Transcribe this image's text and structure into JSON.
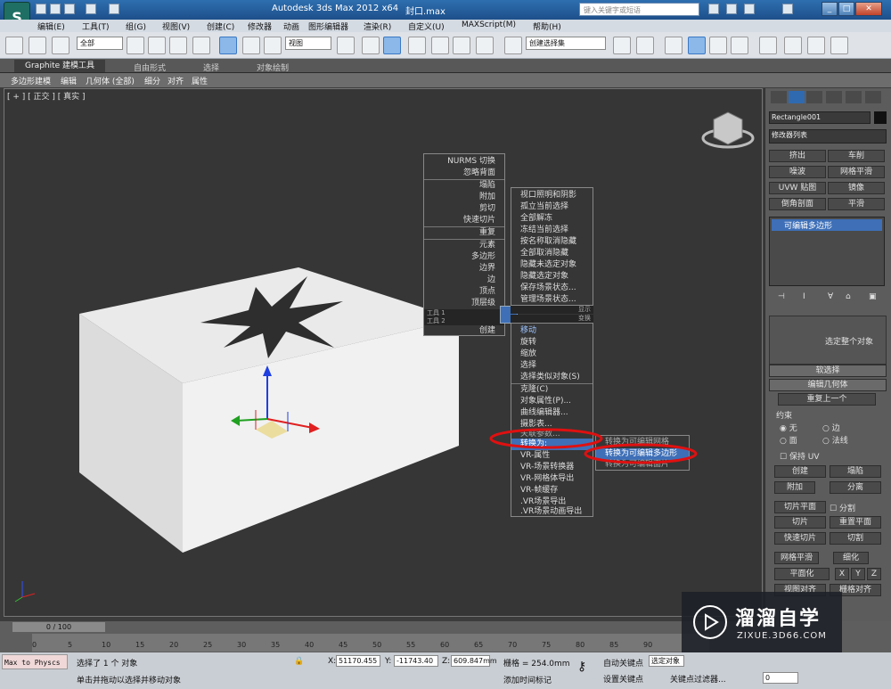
{
  "app": {
    "title": "Autodesk 3ds Max  2012 x64",
    "file": "封口.max",
    "search_placeholder": "键入关键字或短语",
    "logo": "S"
  },
  "menubar": [
    "编辑(E)",
    "工具(T)",
    "组(G)",
    "视图(V)",
    "创建(C)",
    "修改器",
    "动画",
    "图形编辑器",
    "渲染(R)",
    "自定义(U)",
    "MAXScript(M)",
    "帮助(H)"
  ],
  "toolbar": {
    "selection_filter": "全部",
    "ref_coord": "视图",
    "named_selection": "创建选择集"
  },
  "ribbon": {
    "tabs": [
      "Graphite 建模工具",
      "自由形式",
      "选择",
      "对象绘制"
    ],
    "sub": [
      "多边形建模",
      "编辑",
      "几何体 (全部)",
      "细分",
      "对齐",
      "属性"
    ]
  },
  "viewport": {
    "label": "[ + ] [ 正交 ] [ 真实 ]"
  },
  "quad_menu": {
    "left": {
      "top_items": [
        "NURMS 切换",
        "忽略背面",
        "塌陷",
        "附加",
        "剪切",
        "快速切片",
        "重复"
      ],
      "sub_items": [
        "元素",
        "多边形",
        "边界",
        "边",
        "顶点",
        "顶层级"
      ],
      "hdr1": "工具 1",
      "hdr2": "工具 2",
      "create": "创建"
    },
    "right_top": [
      "视口照明和阴影",
      "孤立当前选择",
      "全部解冻",
      "冻结当前选择",
      "按名称取消隐藏",
      "全部取消隐藏",
      "隐藏未选定对象",
      "隐藏选定对象",
      "保存场景状态...",
      "管理场景状态..."
    ],
    "hdr_right1": "显示",
    "hdr_right2": "变换",
    "right_bottom": [
      "移动",
      "旋转",
      "缩放",
      "选择",
      "选择类似对象(S)",
      "克隆(C)",
      "对象属性(P)...",
      "曲线编辑器...",
      "摄影表...",
      "关联参数...",
      "转换为:",
      "VR-属性",
      "VR-场景转换器",
      "VR-网格体导出",
      "VR-帧缓存",
      ".VR场景导出",
      ".VR场景动画导出"
    ],
    "convert_sub": [
      "转换为可编辑网格",
      "转换为可编辑多边形",
      "转换为可编辑面片"
    ]
  },
  "cmdpanel": {
    "object_name": "Rectangle001",
    "modifier_list": "修改器列表",
    "mod_buttons": [
      "挤出",
      "车削",
      "噪波",
      "网格平滑",
      "UVW 贴图",
      "镜像",
      "倒角剖面",
      "平滑"
    ],
    "stack_item": "可编辑多边形",
    "select_whole": "选定整个对象",
    "soft_select": "软选择",
    "edit_geometry": "编辑几何体",
    "repeat_last": "重复上一个",
    "constraints": "约束",
    "constraint_opts": [
      "无",
      "边",
      "面",
      "法线"
    ],
    "preserve_uv": "保持 UV",
    "geo_buttons": [
      "创建",
      "塌陷",
      "附加",
      "分离",
      "切片平面",
      "分割",
      "切片",
      "重置平面",
      "快速切片",
      "切割",
      "网格平滑",
      "细化",
      "平面化",
      "X",
      "Y",
      "Z",
      "视图对齐",
      "栅格对齐"
    ]
  },
  "timeline": {
    "frame": "0 / 100",
    "ticks": [
      "0",
      "5",
      "10",
      "15",
      "20",
      "25",
      "30",
      "35",
      "40",
      "45",
      "50",
      "55",
      "60",
      "65",
      "70",
      "75",
      "80",
      "85",
      "90"
    ]
  },
  "status": {
    "maxscript": "Max to Physcs",
    "line1": "选择了 1 个 对象",
    "line2": "单击并拖动以选择并移动对象",
    "x_label": "X:",
    "x_val": "51170.455",
    "y_label": "Y:",
    "y_val": "-11743.40",
    "z_label": "Z:",
    "z_val": "609.847mm",
    "grid": "栅格 = 254.0mm",
    "add_tag": "添加时间标记",
    "autokey": "自动关键点",
    "selected": "选定对象",
    "setkey": "设置关键点",
    "keyfilter": "关键点过滤器...",
    "frame_val": "0"
  },
  "watermark": {
    "brand": "溜溜自学",
    "url": "ZIXUE.3D66.COM"
  }
}
